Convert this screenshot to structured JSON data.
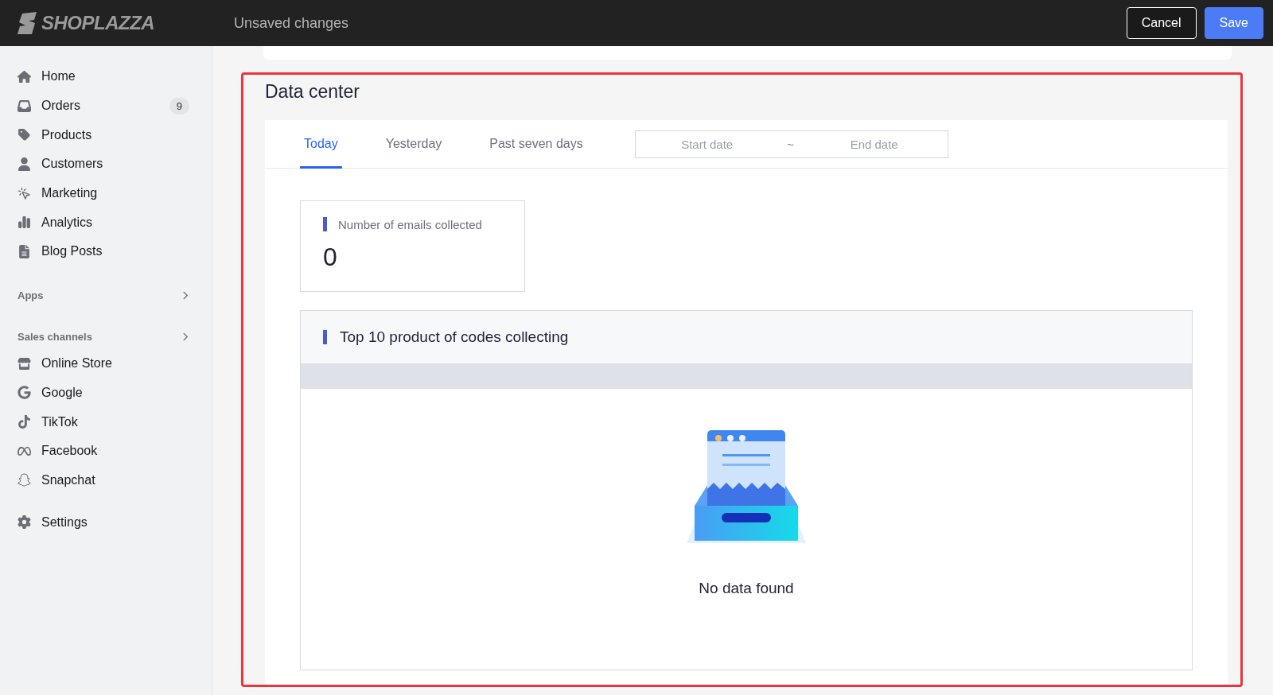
{
  "top_bar": {
    "logo": "SHOPLAZZA",
    "status": "Unsaved changes",
    "buttons": [
      {
        "label": "Cancel",
        "kind": "secondary"
      },
      {
        "label": "Save",
        "kind": "primary"
      }
    ]
  },
  "sidebar": {
    "items": [
      {
        "label": "Home"
      },
      {
        "label": "Orders",
        "badge": "9"
      },
      {
        "label": "Products"
      },
      {
        "label": "Customers"
      },
      {
        "label": "Marketing"
      },
      {
        "label": "Analytics"
      },
      {
        "label": "Blog Posts"
      }
    ],
    "sections": [
      {
        "title": "Apps"
      },
      {
        "title": "Sales channels",
        "items": [
          {
            "label": "Online Store"
          },
          {
            "label": "Google"
          },
          {
            "label": "TikTok"
          },
          {
            "label": "Facebook"
          },
          {
            "label": "Snapchat"
          }
        ]
      }
    ],
    "settings": {
      "label": "Settings"
    }
  },
  "page": {
    "title": "Data center",
    "tabs": [
      {
        "label": "Today",
        "selected": true
      },
      {
        "label": "Yesterday",
        "selected": false
      },
      {
        "label": "Past seven days",
        "selected": false
      }
    ],
    "date_range": {
      "start_placeholder": "Start date",
      "separator": "~",
      "end_placeholder": "End date"
    },
    "stat": {
      "label": "Number of emails collected",
      "value": "0"
    },
    "table": {
      "title": "Top 10 product of codes collecting",
      "empty_text": "No data found"
    }
  }
}
